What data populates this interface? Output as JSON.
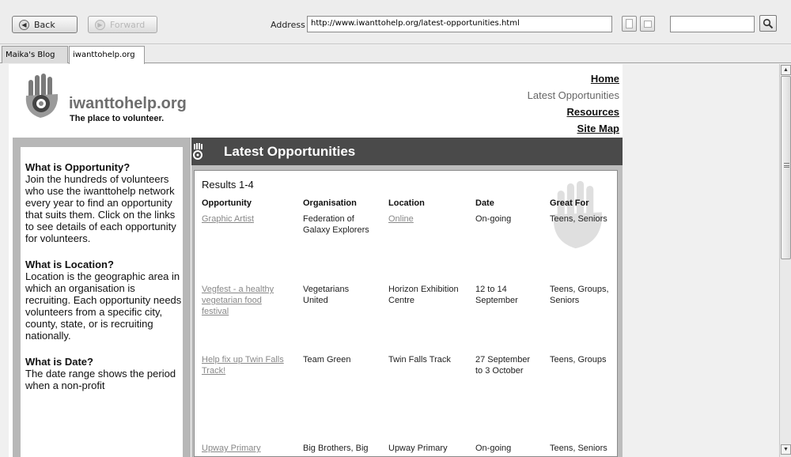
{
  "browser": {
    "back_label": "Back",
    "forward_label": "Forward",
    "address_label": "Address",
    "address_url": "http://www.iwanttohelp.org/latest-opportunities.html",
    "search_value": "",
    "tabs": [
      {
        "label": "Maika's Blog"
      },
      {
        "label": "iwanttohelp.org"
      }
    ]
  },
  "site": {
    "name": "iwanttohelp.org",
    "tagline": "The place to volunteer.",
    "nav": {
      "home": "Home",
      "latest": "Latest Opportunities",
      "resources": "Resources",
      "sitemap": "Site Map"
    }
  },
  "sidebar": {
    "sections": [
      {
        "heading": "What is Opportunity?",
        "text": "Join the hundreds of volunteers who use the iwanttohelp network every year to find an opportunity that suits them. Click on the links to see details of each opportunity for volunteers."
      },
      {
        "heading": "What is Location?",
        "text": "Location is the geographic area in which an organisation is recruiting. Each opportunity needs volunteers from a specific city, county, state, or is recruiting nationally."
      },
      {
        "heading": "What is Date?",
        "text": "The date range shows the period when a non-profit"
      }
    ]
  },
  "content": {
    "title": "Latest Opportunities",
    "results_label": "Results 1-4",
    "columns": {
      "opportunity": "Opportunity",
      "organisation": "Organisation",
      "location": "Location",
      "date": "Date",
      "great_for": "Great For"
    },
    "rows": [
      {
        "opportunity": [
          "Graphic Artist"
        ],
        "organisation": [
          "Federation of",
          "Galaxy Explorers"
        ],
        "location": [
          "Online"
        ],
        "date": [
          "On-going"
        ],
        "great_for": [
          "Teens, Seniors"
        ]
      },
      {
        "opportunity": [
          "Vegfest - a healthy",
          "vegetarian food",
          "festival"
        ],
        "organisation": [
          "Vegetarians",
          "United"
        ],
        "location": [
          "Horizon Exhibition",
          "Centre"
        ],
        "date": [
          "12 to 14",
          "September"
        ],
        "great_for": [
          "Teens, Groups,",
          "Seniors"
        ]
      },
      {
        "opportunity": [
          "Help fix up Twin Falls",
          "Track!"
        ],
        "organisation": [
          "Team Green"
        ],
        "location": [
          "Twin Falls Track"
        ],
        "date": [
          "27 September",
          "to 3 October"
        ],
        "great_for": [
          "Teens, Groups"
        ]
      },
      {
        "opportunity": [
          "Upway Primary"
        ],
        "organisation": [
          "Big Brothers, Big"
        ],
        "location": [
          "Upway Primary"
        ],
        "date": [
          "On-going"
        ],
        "great_for": [
          "Teens, Seniors"
        ]
      }
    ]
  }
}
